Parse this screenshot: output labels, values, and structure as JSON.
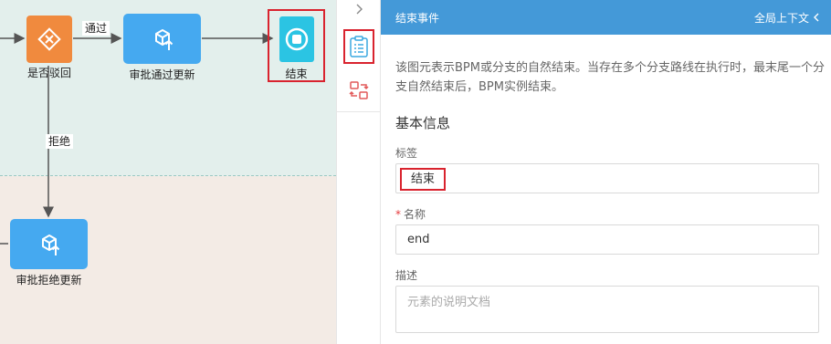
{
  "canvas": {
    "nodes": {
      "gateway_label": "是否驳回",
      "approve_task_label": "审批通过更新",
      "reject_task_label": "审批拒绝更新",
      "end_label": "结束"
    },
    "edges": {
      "pass_label": "通过",
      "reject_label": "拒绝"
    }
  },
  "strip": {
    "toggle_icon": "chevron-right-icon",
    "props_icon": "clipboard-list-icon",
    "flow_icon": "swap-icon",
    "active_color": "#d9232e"
  },
  "panel": {
    "header": {
      "title": "结束事件",
      "context_label": "全局上下文",
      "bg_color": "#4499d8"
    },
    "description": "该图元表示BPM或分支的自然结束。当存在多个分支路线在执行时，最末尾一个分支自然结束后，BPM实例结束。",
    "section_title": "基本信息",
    "fields": {
      "label_label": "标签",
      "label_value": "结束",
      "name_label": "名称",
      "name_required": "*",
      "name_value": "end",
      "desc_label": "描述",
      "desc_placeholder": "元素的说明文档"
    }
  }
}
